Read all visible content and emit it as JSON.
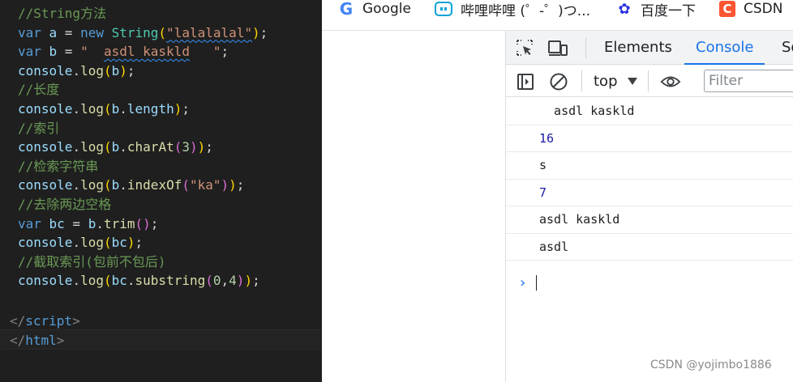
{
  "editor": {
    "lines": [
      {
        "tokens": [
          {
            "t": "//String方法",
            "c": "comment"
          }
        ]
      },
      {
        "tokens": [
          {
            "t": "var ",
            "c": "keyword"
          },
          {
            "t": "a",
            "c": "var"
          },
          {
            "t": " = ",
            "c": "punct"
          },
          {
            "t": "new ",
            "c": "keyword"
          },
          {
            "t": "String",
            "c": "class"
          },
          {
            "t": "(",
            "c": "paren1"
          },
          {
            "t": "\"lalalalal\"",
            "c": "string",
            "squiggle": true
          },
          {
            "t": ")",
            "c": "paren1"
          },
          {
            "t": ";",
            "c": "punct"
          }
        ]
      },
      {
        "tokens": [
          {
            "t": "var ",
            "c": "keyword"
          },
          {
            "t": "b",
            "c": "var"
          },
          {
            "t": " = ",
            "c": "punct"
          },
          {
            "t": "\"  ",
            "c": "string"
          },
          {
            "t": "asdl kaskld",
            "c": "string",
            "squiggle": true
          },
          {
            "t": "   \"",
            "c": "string"
          },
          {
            "t": ";",
            "c": "punct"
          }
        ]
      },
      {
        "tokens": [
          {
            "t": "console",
            "c": "var"
          },
          {
            "t": ".",
            "c": "punct"
          },
          {
            "t": "log",
            "c": "func"
          },
          {
            "t": "(",
            "c": "paren1"
          },
          {
            "t": "b",
            "c": "var"
          },
          {
            "t": ")",
            "c": "paren1"
          },
          {
            "t": ";",
            "c": "punct"
          }
        ]
      },
      {
        "tokens": [
          {
            "t": "//长度",
            "c": "comment"
          }
        ]
      },
      {
        "tokens": [
          {
            "t": "console",
            "c": "var"
          },
          {
            "t": ".",
            "c": "punct"
          },
          {
            "t": "log",
            "c": "func"
          },
          {
            "t": "(",
            "c": "paren1"
          },
          {
            "t": "b",
            "c": "var"
          },
          {
            "t": ".",
            "c": "punct"
          },
          {
            "t": "length",
            "c": "var"
          },
          {
            "t": ")",
            "c": "paren1"
          },
          {
            "t": ";",
            "c": "punct"
          }
        ]
      },
      {
        "tokens": [
          {
            "t": "//索引",
            "c": "comment"
          }
        ]
      },
      {
        "tokens": [
          {
            "t": "console",
            "c": "var"
          },
          {
            "t": ".",
            "c": "punct"
          },
          {
            "t": "log",
            "c": "func"
          },
          {
            "t": "(",
            "c": "paren1"
          },
          {
            "t": "b",
            "c": "var"
          },
          {
            "t": ".",
            "c": "punct"
          },
          {
            "t": "charAt",
            "c": "func"
          },
          {
            "t": "(",
            "c": "paren2"
          },
          {
            "t": "3",
            "c": "number"
          },
          {
            "t": ")",
            "c": "paren2"
          },
          {
            "t": ")",
            "c": "paren1"
          },
          {
            "t": ";",
            "c": "punct"
          }
        ]
      },
      {
        "tokens": [
          {
            "t": "//检索字符串",
            "c": "comment"
          }
        ]
      },
      {
        "tokens": [
          {
            "t": "console",
            "c": "var"
          },
          {
            "t": ".",
            "c": "punct"
          },
          {
            "t": "log",
            "c": "func"
          },
          {
            "t": "(",
            "c": "paren1"
          },
          {
            "t": "b",
            "c": "var"
          },
          {
            "t": ".",
            "c": "punct"
          },
          {
            "t": "indexOf",
            "c": "func"
          },
          {
            "t": "(",
            "c": "paren2"
          },
          {
            "t": "\"ka\"",
            "c": "string"
          },
          {
            "t": ")",
            "c": "paren2"
          },
          {
            "t": ")",
            "c": "paren1"
          },
          {
            "t": ";",
            "c": "punct"
          }
        ]
      },
      {
        "tokens": [
          {
            "t": "//去除两边空格",
            "c": "comment"
          }
        ]
      },
      {
        "tokens": [
          {
            "t": "var ",
            "c": "keyword"
          },
          {
            "t": "bc",
            "c": "var"
          },
          {
            "t": " = ",
            "c": "punct"
          },
          {
            "t": "b",
            "c": "var"
          },
          {
            "t": ".",
            "c": "punct"
          },
          {
            "t": "trim",
            "c": "func"
          },
          {
            "t": "(",
            "c": "paren2"
          },
          {
            "t": ")",
            "c": "paren2"
          },
          {
            "t": ";",
            "c": "punct"
          }
        ]
      },
      {
        "tokens": [
          {
            "t": "console",
            "c": "var"
          },
          {
            "t": ".",
            "c": "punct"
          },
          {
            "t": "log",
            "c": "func"
          },
          {
            "t": "(",
            "c": "paren1"
          },
          {
            "t": "bc",
            "c": "var"
          },
          {
            "t": ")",
            "c": "paren1"
          },
          {
            "t": ";",
            "c": "punct"
          }
        ]
      },
      {
        "tokens": [
          {
            "t": "//截取索引(包前不包后)",
            "c": "comment"
          }
        ]
      },
      {
        "tokens": [
          {
            "t": "console",
            "c": "var"
          },
          {
            "t": ".",
            "c": "punct"
          },
          {
            "t": "log",
            "c": "func"
          },
          {
            "t": "(",
            "c": "paren1"
          },
          {
            "t": "bc",
            "c": "var"
          },
          {
            "t": ".",
            "c": "punct"
          },
          {
            "t": "substring",
            "c": "func"
          },
          {
            "t": "(",
            "c": "paren2"
          },
          {
            "t": "0",
            "c": "number"
          },
          {
            "t": ",",
            "c": "punct"
          },
          {
            "t": "4",
            "c": "number"
          },
          {
            "t": ")",
            "c": "paren2"
          },
          {
            "t": ")",
            "c": "paren1"
          },
          {
            "t": ";",
            "c": "punct"
          }
        ]
      }
    ],
    "closing_lines": [
      {
        "tokens": [
          {
            "t": "</",
            "c": "bracket"
          },
          {
            "t": "script",
            "c": "tag"
          },
          {
            "t": ">",
            "c": "bracket"
          }
        ]
      },
      {
        "tokens": [
          {
            "t": "</",
            "c": "bracket"
          },
          {
            "t": "html",
            "c": "tag"
          },
          {
            "t": ">",
            "c": "bracket"
          }
        ]
      }
    ]
  },
  "bookmarks": [
    {
      "label": "Google",
      "icon": "google-icon",
      "glyph": "G"
    },
    {
      "label": "哔哩哔哩 (゜-゜)つ...",
      "icon": "bilibili-icon",
      "glyph": ""
    },
    {
      "label": "百度一下",
      "icon": "baidu-icon",
      "glyph": "✿"
    },
    {
      "label": "CSDN",
      "icon": "csdn-icon",
      "glyph": "C"
    }
  ],
  "devtools": {
    "tabs": [
      "Elements",
      "Console",
      "So"
    ],
    "active_tab": "Console",
    "context": "top",
    "filter_placeholder": "Filter",
    "console_messages": [
      {
        "text": "  asdl kaskld   ",
        "kind": "string"
      },
      {
        "text": "16",
        "kind": "number"
      },
      {
        "text": "s",
        "kind": "string"
      },
      {
        "text": "7",
        "kind": "number"
      },
      {
        "text": "asdl kaskld",
        "kind": "string"
      },
      {
        "text": "asdl",
        "kind": "string"
      }
    ],
    "prompt_symbol": "›"
  },
  "watermark": "CSDN @yojimbo1886",
  "colors": {
    "editor_bg": "#1f1f1f",
    "comment": "#6a9955",
    "keyword": "#569cd6",
    "string": "#ce9178",
    "accent": "#1a73e8",
    "number_output": "#1a1aa6"
  }
}
